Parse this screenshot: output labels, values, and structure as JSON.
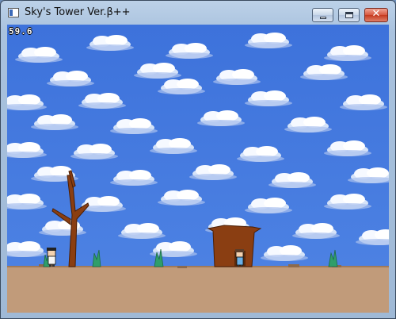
{
  "window": {
    "title": "Sky's Tower Ver.β++",
    "close_glyph": "✕"
  },
  "hud": {
    "fps": "59.6"
  },
  "colors": {
    "sky": "#3a6fd8",
    "cloud": "#e6eefb",
    "ground": "#c19b7a",
    "tree": "#8a3e12",
    "plant": "#2f9e6a"
  }
}
